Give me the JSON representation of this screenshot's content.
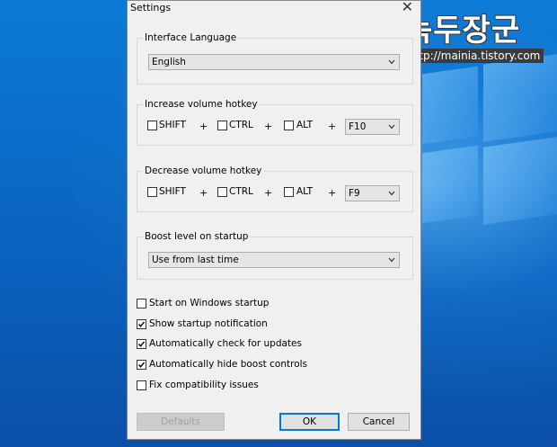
{
  "window": {
    "title": "Settings",
    "close_label": "✕"
  },
  "watermark": {
    "title": "녹두장군",
    "url": "http://mainia.tistory.com"
  },
  "language": {
    "label": "Interface Language",
    "selected": "English"
  },
  "increase_hotkey": {
    "label": "Increase volume hotkey",
    "shift": {
      "label": "SHIFT",
      "checked": false
    },
    "ctrl": {
      "label": "CTRL",
      "checked": false
    },
    "alt": {
      "label": "ALT",
      "checked": false
    },
    "plus": "+",
    "key": "F10"
  },
  "decrease_hotkey": {
    "label": "Decrease volume hotkey",
    "shift": {
      "label": "SHIFT",
      "checked": false
    },
    "ctrl": {
      "label": "CTRL",
      "checked": false
    },
    "alt": {
      "label": "ALT",
      "checked": false
    },
    "plus": "+",
    "key": "F9"
  },
  "boost": {
    "label": "Boost level on startup",
    "selected": "Use from last time"
  },
  "options": [
    {
      "label": "Start on Windows startup",
      "checked": false
    },
    {
      "label": "Show startup notification",
      "checked": true
    },
    {
      "label": "Automatically check for updates",
      "checked": true
    },
    {
      "label": "Automatically hide boost controls",
      "checked": true
    },
    {
      "label": "Fix compatibility issues",
      "checked": false
    }
  ],
  "buttons": {
    "defaults": "Defaults",
    "ok": "OK",
    "cancel": "Cancel"
  },
  "icons": {
    "chevron": "chevron-down-icon",
    "check": "checkmark-icon",
    "close": "close-icon"
  },
  "colors": {
    "accent": "#0078d7",
    "desktop": "#0b6fd0"
  }
}
